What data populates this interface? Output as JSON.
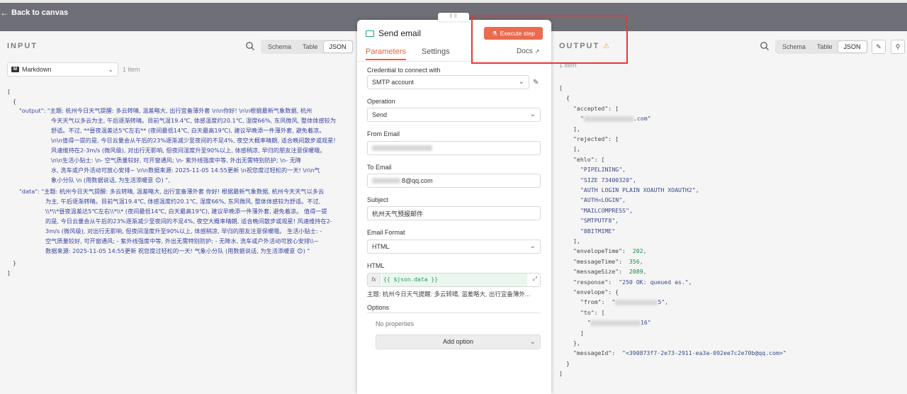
{
  "topbar": {
    "back_label": "Back to canvas"
  },
  "input": {
    "title": "INPUT",
    "tabs": [
      "Schema",
      "Table",
      "JSON"
    ],
    "format_select": "Markdown",
    "item_count": "1 item",
    "lines": [
      "\"output\":  \"主题: 杭州今日天气提醒: 多云转晴, 温差略大, 出行宜备薄外套   \\n\\n你好!    \\n\\n根据最新气象数据, 杭州",
      "今天天气以多云为主, 午后逐渐转晴。目前气温19.4℃, 体感温度约20.1℃, 湿度66%, 东风微风, 整体体感较为",
      "舒适。不过, **昼夜温差达5℃左右** (夜间最低14℃, 白天最高19℃), 建议早晚添一件薄外套, 避免着凉。",
      "\\n\\n值得一提的是, 今日云量会从午后的23%逐渐减少至夜间的不足4%, 夜空大概率晴朗, 适合晚间散步或观星!",
      "风速维持在2-3m/s (微风级), 对出行无影响, 但夜间湿度升至90%以上, 体感稍凉, 早归的朋友注意保暖哦。",
      "\\n\\n生活小贴士:    \\n- 空气质量较好, 可开窗通风;    \\n- 紫外线强度中等, 外出无需特别防护;    \\n- 无降",
      "水, 洗车或户外活动可放心安排~  \\n\\n数据来源: 2025-11-05 14:55更新  \\n祝您度过轻松的一天!    \\n\\n气",
      "象小分队   \\n (用数据说话, 为生活添暖意 😊) \",",
      "\"data\":  \"主题: 杭州今日天气提醒: 多云转晴, 温差略大, 出行宜备薄外套  你好!  根据最新气象数据, 杭州今天天气以多云",
      "为主, 午后逐渐转晴。目前气温19.4℃, 体感温度约20.1℃, 湿度66%, 东风微风, 整体体感较为舒适。不过,",
      "\\\\*\\\\*昼夜温差达5℃左右\\\\*\\\\* (夜间最低14℃, 白天最高19℃), 建议早晚添一件薄外套, 避免着凉。  值得一提",
      "的是, 今日云量会从午后的23%逐渐减少至夜间的不足4%, 夜空大概率晴朗, 适合晚间散步或观星! 风速维持在2-",
      "3m/s (微风级), 对出行无影响, 但夜间湿度升至90%以上, 体感稍凉, 早归的朋友注意保暖哦。  生活小贴士:  -",
      "空气质量较好, 可开窗通风;  - 紫外线强度中等, 外出无需特别防护;  - 无降水, 洗车或户外活动可放心安排\\\\~",
      "数据来源: 2025-11-05 14:55更新  祝您度过轻松的一天!   气象小分队  (用数据说话, 为生活添暖意 😊) \""
    ]
  },
  "node": {
    "title": "Send email",
    "tabs": [
      "Parameters",
      "Settings"
    ],
    "execute_label": "Execute step",
    "docs_label": "Docs",
    "credential_label": "Credential to connect with",
    "credential_value": "SMTP account",
    "operation_label": "Operation",
    "operation_value": "Send",
    "from_label": "From Email",
    "to_label": "To Email",
    "to_value": "8@qq.com",
    "subject_label": "Subject",
    "subject_value": "杭州天气预报邮件",
    "format_label": "Email Format",
    "format_value": "HTML",
    "html_label": "HTML",
    "html_expr": "{{ $json.data }}",
    "html_preview": "主题: 杭州今日天气提醒: 多云转晴, 温差略大, 出行宜备薄外...",
    "options_label": "Options",
    "no_props": "No properties",
    "add_option": "Add option"
  },
  "output": {
    "title": "OUTPUT",
    "tabs": [
      "Schema",
      "Table",
      "JSON"
    ],
    "item_count": "1 item",
    "lines": [
      {
        "t": "[",
        "i": 0
      },
      {
        "t": "{",
        "i": 1
      },
      {
        "t": "\"accepted\": [",
        "i": 2
      },
      {
        "t": "\".com\"",
        "i": 3,
        "blur": true
      },
      {
        "t": "],",
        "i": 2
      },
      {
        "t": "\"rejected\": [",
        "i": 2
      },
      {
        "t": "],",
        "i": 2
      },
      {
        "t": "\"ehlo\": [",
        "i": 2
      },
      {
        "t": "\"PIPELINING\",",
        "i": 3
      },
      {
        "t": "\"SIZE 73400320\",",
        "i": 3
      },
      {
        "t": "\"AUTH LOGIN PLAIN XOAUTH XOAUTH2\",",
        "i": 3
      },
      {
        "t": "\"AUTH=LOGIN\",",
        "i": 3
      },
      {
        "t": "\"MAILCOMPRESS\",",
        "i": 3
      },
      {
        "t": "\"SMTPUTF8\",",
        "i": 3
      },
      {
        "t": "\"8BITMIME\"",
        "i": 3
      },
      {
        "t": "],",
        "i": 2
      },
      {
        "t": "\"envelopeTime\":  202,",
        "i": 2
      },
      {
        "t": "\"messageTime\":  356,",
        "i": 2
      },
      {
        "t": "\"messageSize\":  2089,",
        "i": 2
      },
      {
        "t": "\"response\":  \"250 OK: queued as.\",",
        "i": 2
      },
      {
        "t": "\"envelope\": {",
        "i": 2
      },
      {
        "t": "\"from\":  \"5\",",
        "i": 3,
        "blur": true
      },
      {
        "t": "\"to\": [",
        "i": 3
      },
      {
        "t": "\"16\"",
        "i": 4,
        "blur": true
      },
      {
        "t": "]",
        "i": 3
      },
      {
        "t": "},",
        "i": 2
      },
      {
        "t": "\"messageId\":  \"<390873f7-2e73-2911-ea3a-092ee7c2e70b@qq.com>\"",
        "i": 2
      },
      {
        "t": "}",
        "i": 1
      },
      {
        "t": "]",
        "i": 0
      }
    ]
  },
  "colors": {
    "accent": "#e8603c",
    "execute": "#ea6b4f",
    "highlight_box": "#e53935",
    "string": "#3a46a0",
    "number": "#198a4a"
  }
}
